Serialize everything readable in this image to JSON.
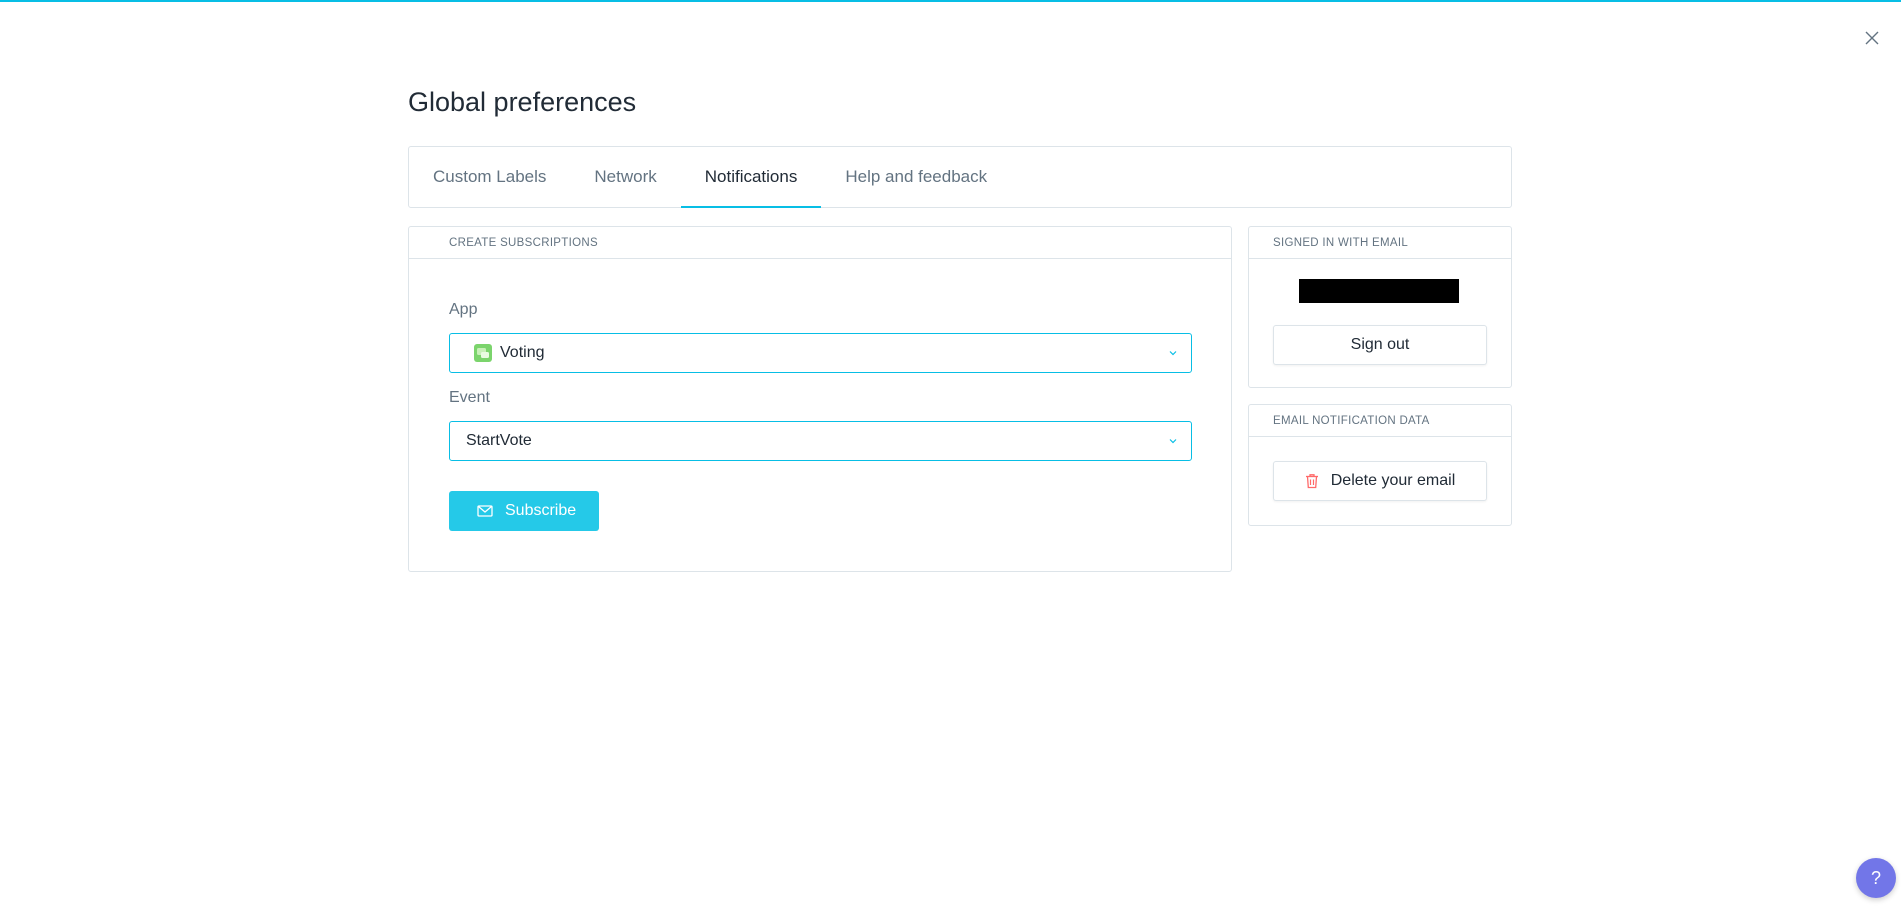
{
  "page": {
    "title": "Global preferences"
  },
  "tabs": [
    {
      "label": "Custom Labels",
      "active": false
    },
    {
      "label": "Network",
      "active": false
    },
    {
      "label": "Notifications",
      "active": true
    },
    {
      "label": "Help and feedback",
      "active": false
    }
  ],
  "subscriptions": {
    "header": "CREATE SUBSCRIPTIONS",
    "app_label": "App",
    "app_value": "Voting",
    "app_icon": "voting-app-icon",
    "event_label": "Event",
    "event_value": "StartVote",
    "subscribe_label": "Subscribe",
    "subscribe_icon": "mail-icon"
  },
  "signed_in": {
    "header": "SIGNED IN WITH EMAIL",
    "sign_out_label": "Sign out"
  },
  "email_data": {
    "header": "EMAIL NOTIFICATION DATA",
    "delete_label": "Delete your email",
    "delete_icon": "trash-icon"
  },
  "help": {
    "label": "?"
  },
  "colors": {
    "accent": "#08bee5",
    "primary_button": "#25c9e8",
    "help_button": "#7276e8",
    "danger_icon": "#ff6969"
  }
}
